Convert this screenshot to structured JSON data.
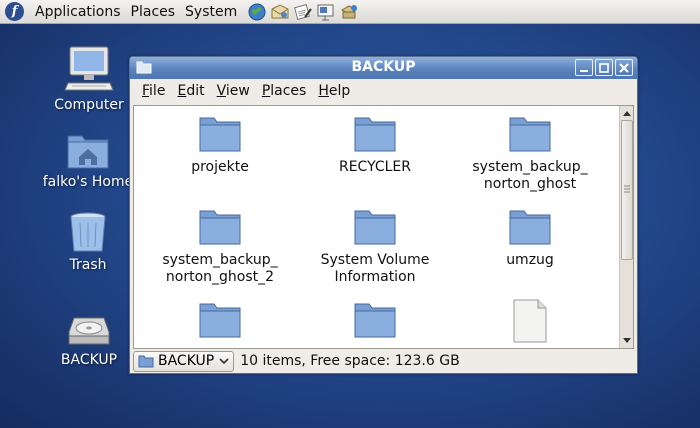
{
  "panel": {
    "menus": [
      "Applications",
      "Places",
      "System"
    ],
    "launchers": [
      "web-browser-icon",
      "mail-icon",
      "text-editor-icon",
      "presentation-icon",
      "network-icon"
    ]
  },
  "desktop": {
    "icons": [
      {
        "label": "Computer"
      },
      {
        "label": "falko's Home"
      },
      {
        "label": "Trash"
      },
      {
        "label": "BACKUP"
      }
    ]
  },
  "window": {
    "title": "BACKUP",
    "menu": [
      {
        "mnemonic": "F",
        "rest": "ile"
      },
      {
        "mnemonic": "E",
        "rest": "dit"
      },
      {
        "mnemonic": "V",
        "rest": "iew"
      },
      {
        "mnemonic": "P",
        "rest": "laces"
      },
      {
        "mnemonic": "H",
        "rest": "elp"
      }
    ],
    "items": [
      {
        "line1": "projekte",
        "line2": ""
      },
      {
        "line1": "RECYCLER",
        "line2": ""
      },
      {
        "line1": "system_backup_",
        "line2": "norton_ghost"
      },
      {
        "line1": "system_backup_",
        "line2": "norton_ghost_2"
      },
      {
        "line1": "System Volume",
        "line2": "Information"
      },
      {
        "line1": "umzug",
        "line2": ""
      }
    ],
    "location": "BACKUP",
    "status": "10 items, Free space: 123.6 GB"
  },
  "colors": {
    "desktop": "#23498d",
    "titlebar": "#5b84bf",
    "folder": "#7a9fd2"
  }
}
